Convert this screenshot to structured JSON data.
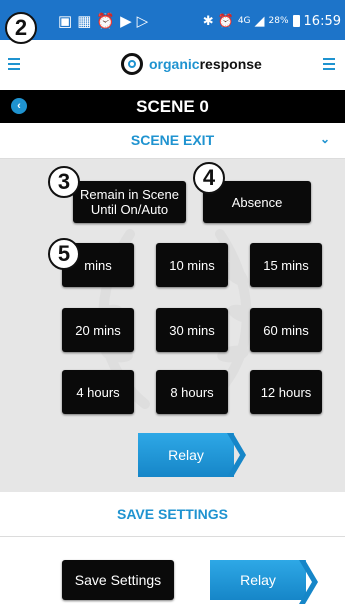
{
  "callouts": {
    "statusbar": "2",
    "remain": "3",
    "absence": "4",
    "time": "5"
  },
  "statusbar": {
    "network": "4G",
    "battery": "28%",
    "time": "16:59"
  },
  "header": {
    "logo_part1": "organic",
    "logo_part2": "response"
  },
  "scene": {
    "title": "SCENE 0"
  },
  "scene_exit": {
    "title": "SCENE EXIT",
    "remain_label": "Remain in Scene Until On/Auto",
    "absence_label": "Absence",
    "times": [
      "mins",
      "10 mins",
      "15 mins",
      "20 mins",
      "30 mins",
      "60 mins",
      "4 hours",
      "8 hours",
      "12 hours"
    ],
    "relay_label": "Relay"
  },
  "save": {
    "title": "SAVE SETTINGS",
    "button_label": "Save Settings",
    "relay_label": "Relay"
  },
  "colors": {
    "accent": "#1f93d0",
    "statusbar": "#1d74c9",
    "panel": "#e6e6e6"
  }
}
